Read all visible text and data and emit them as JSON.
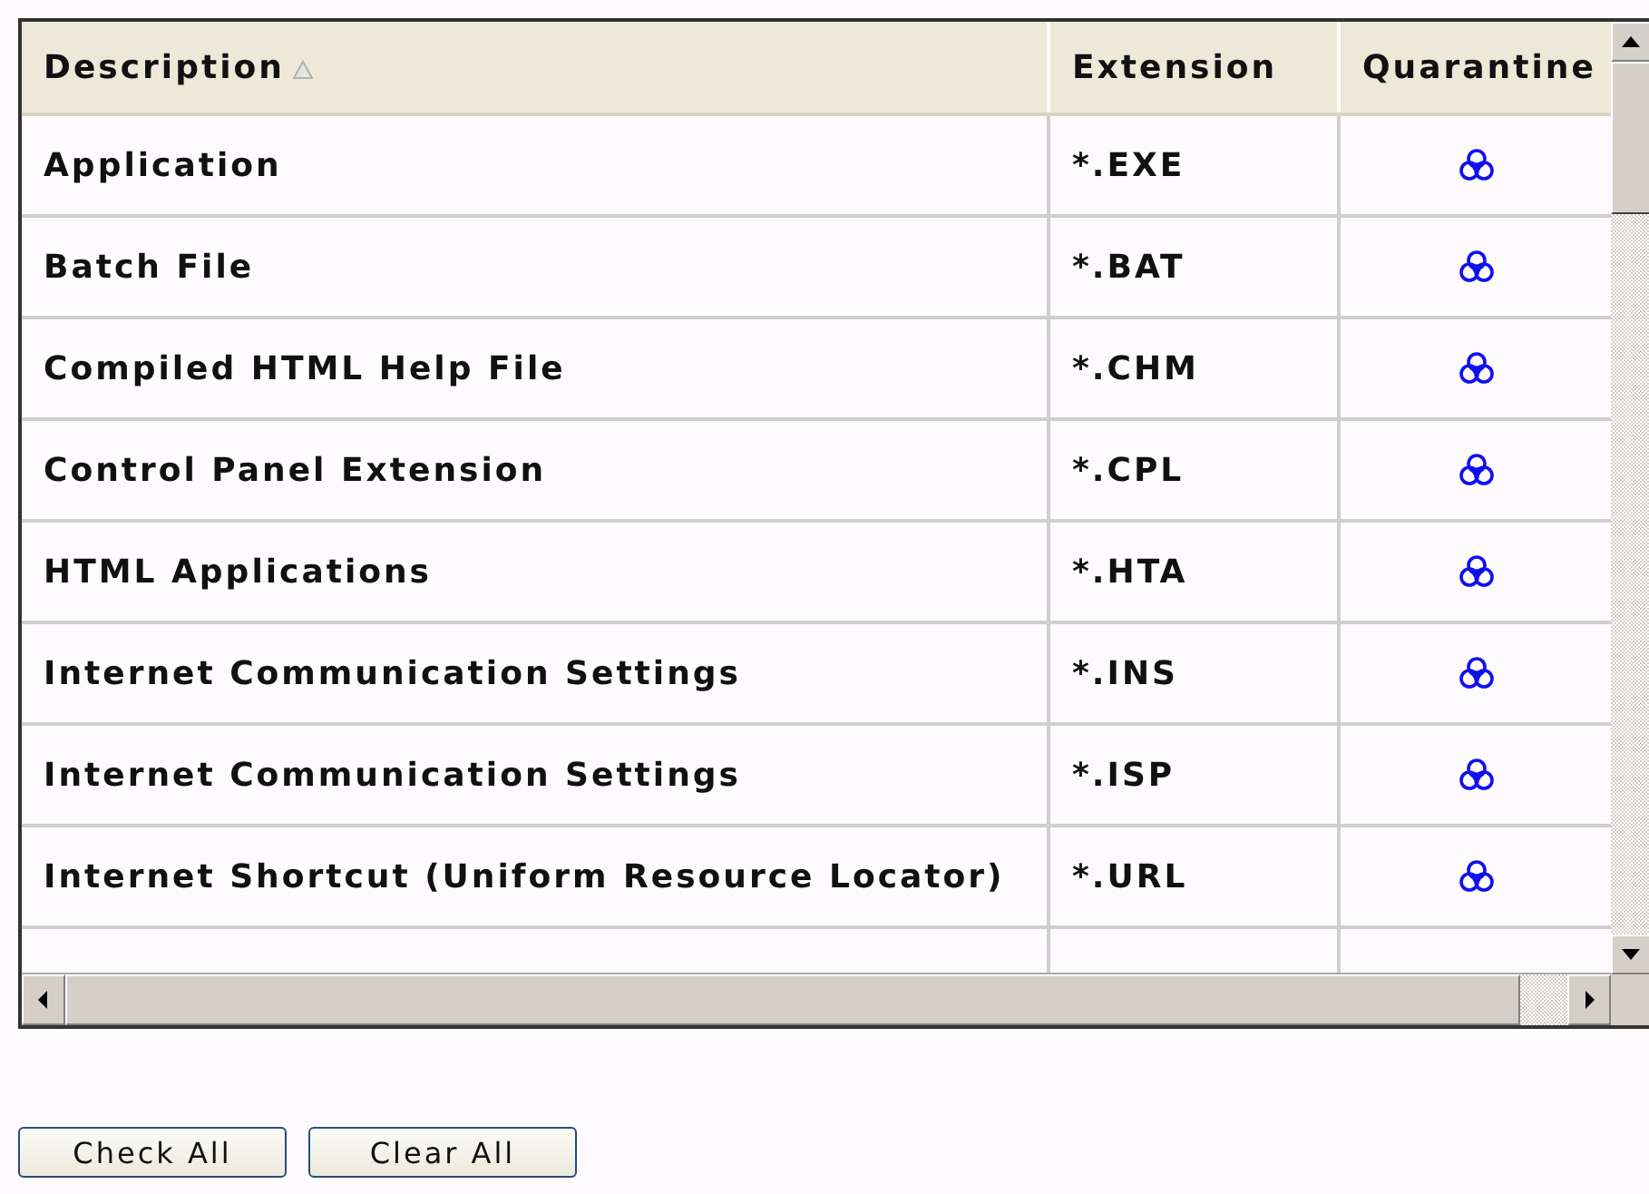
{
  "table": {
    "columns": [
      {
        "label": "Description",
        "sorted": true
      },
      {
        "label": "Extension",
        "sorted": false
      },
      {
        "label": "Quarantine",
        "sorted": false
      }
    ],
    "rows": [
      {
        "description": "Application",
        "extension": "*.EXE",
        "quarantine": true
      },
      {
        "description": "Batch File",
        "extension": "*.BAT",
        "quarantine": true
      },
      {
        "description": "Compiled HTML Help File",
        "extension": "*.CHM",
        "quarantine": true
      },
      {
        "description": "Control Panel Extension",
        "extension": "*.CPL",
        "quarantine": true
      },
      {
        "description": "HTML Applications",
        "extension": "*.HTA",
        "quarantine": true
      },
      {
        "description": "Internet Communication Settings",
        "extension": "*.INS",
        "quarantine": true
      },
      {
        "description": "Internet Communication Settings",
        "extension": "*.ISP",
        "quarantine": true
      },
      {
        "description": "Internet Shortcut (Uniform Resource Locator)",
        "extension": "*.URL",
        "quarantine": true
      }
    ]
  },
  "buttons": [
    "Check All",
    "Clear All"
  ]
}
